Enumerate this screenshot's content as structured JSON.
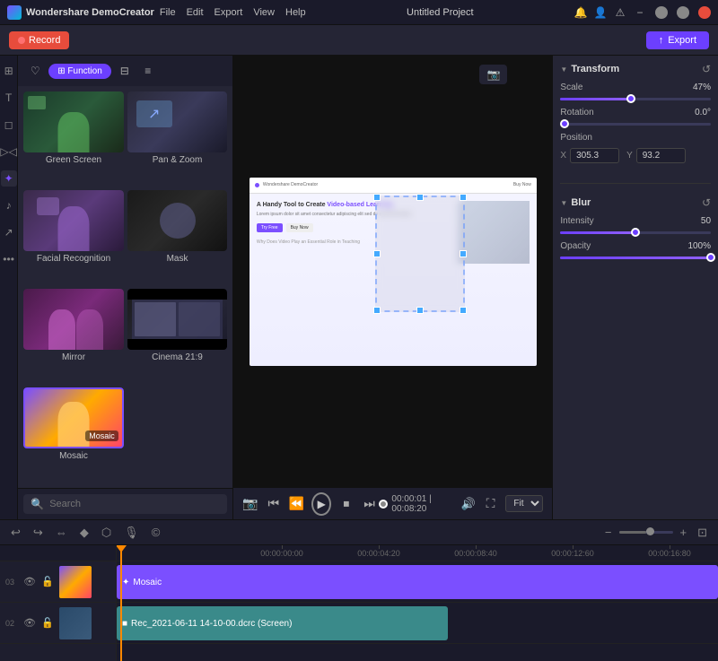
{
  "titleBar": {
    "appName": "Wondershare DemoCreator",
    "menu": [
      "File",
      "Edit",
      "Export",
      "View",
      "Help"
    ],
    "projectTitle": "Untitled Project"
  },
  "toolbar": {
    "recordLabel": "Record",
    "exportLabel": "Export"
  },
  "effectsPanel": {
    "tabs": [
      {
        "id": "favorites",
        "label": "♡",
        "icon": true
      },
      {
        "id": "function",
        "label": "Function",
        "active": true
      },
      {
        "id": "tab2",
        "label": "⊟",
        "icon": true
      },
      {
        "id": "tab3",
        "label": "≡",
        "icon": true
      }
    ],
    "effects": [
      {
        "id": "green-screen",
        "label": "Green Screen",
        "thumbClass": "thumb-green"
      },
      {
        "id": "pan-zoom",
        "label": "Pan & Zoom",
        "thumbClass": "thumb-panzoom"
      },
      {
        "id": "facial-recognition",
        "label": "Facial Recognition",
        "thumbClass": "thumb-facial"
      },
      {
        "id": "mask",
        "label": "Mask",
        "thumbClass": "thumb-mask"
      },
      {
        "id": "mirror",
        "label": "Mirror",
        "thumbClass": "thumb-mirror"
      },
      {
        "id": "cinema-21-9",
        "label": "Cinema 21:9",
        "thumbClass": "thumb-cinema"
      },
      {
        "id": "mosaic",
        "label": "Mosaic",
        "thumbClass": "thumb-mosaic",
        "badge": "Mosaic"
      }
    ],
    "searchPlaceholder": "Search"
  },
  "preview": {
    "timeDisplay": "00:00:01 | 00:08:20",
    "cameraIcon": "📷",
    "fitLabel": "Fit"
  },
  "rightPanel": {
    "transform": {
      "title": "Transform",
      "scaleLabel": "Scale",
      "scaleValue": "47%",
      "rotationLabel": "Rotation",
      "rotationValue": "0.0°",
      "positionLabel": "Position",
      "xLabel": "X",
      "xValue": "305.3",
      "yLabel": "Y",
      "yValue": "93.2"
    },
    "blur": {
      "title": "Blur",
      "intensityLabel": "Intensity",
      "intensityValue": "50",
      "opacityLabel": "Opacity",
      "opacityValue": "100%"
    }
  },
  "timeline": {
    "rulers": [
      "00:00:00:00",
      "00:00:04:20",
      "00:00:08:40",
      "00:00:12:60",
      "00:00:16:80"
    ],
    "tracks": [
      {
        "number": "03",
        "clipLabel": "✦ Mosaic",
        "clipType": "mosaic",
        "hasThumb": true,
        "thumbType": "mosaic"
      },
      {
        "number": "02",
        "clipLabel": "■ Rec_2021-06-11 14-10-00.dcrc (Screen)",
        "clipType": "rec",
        "hasThumb": true,
        "thumbType": "rec"
      }
    ],
    "zoomLabel": "Fit"
  }
}
